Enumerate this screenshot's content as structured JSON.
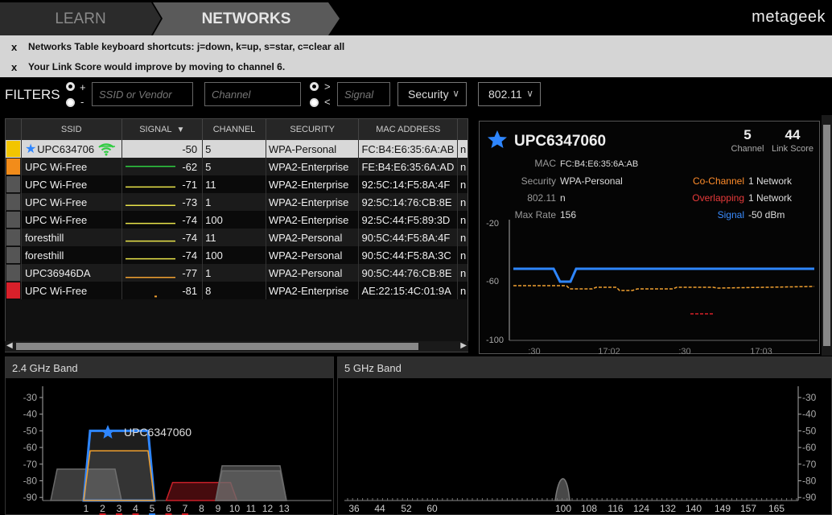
{
  "nav": {
    "learn": "LEARN",
    "networks": "NETWORKS",
    "logo": "metageek"
  },
  "notices": [
    {
      "close": "x",
      "text": "Networks Table keyboard shortcuts: j=down, k=up, s=star, c=clear all"
    },
    {
      "close": "x",
      "text": "Your Link Score would improve by moving to channel 6."
    }
  ],
  "filters": {
    "label": "FILTERS",
    "plus": "+",
    "minus": "-",
    "gt": ">",
    "lt": "<",
    "ssid_placeholder": "SSID or Vendor",
    "channel_placeholder": "Channel",
    "signal_placeholder": "Signal",
    "security": "Security",
    "standard": "802.11"
  },
  "table": {
    "headers": {
      "ssid": "SSID",
      "signal": "SIGNAL",
      "channel": "CHANNEL",
      "security": "SECURITY",
      "mac": "MAC ADDRESS",
      "sort_arrow": "▼"
    },
    "rows": [
      {
        "color": "#f2c500",
        "ssid": "UPC634706",
        "signal": "-50",
        "channel": "5",
        "security": "WPA-Personal",
        "mac": "FC:B4:E6:35:6A:AB",
        "extra": "n",
        "spark": "#2ecc40",
        "starred": true
      },
      {
        "color": "#f28c1a",
        "ssid": "UPC Wi-Free",
        "signal": "-62",
        "channel": "5",
        "security": "WPA2-Enterprise",
        "mac": "FE:B4:E6:35:6A:AD",
        "extra": "n",
        "spark": "#2ecc40"
      },
      {
        "color": "#555555",
        "ssid": "UPC Wi-Free",
        "signal": "-71",
        "channel": "11",
        "security": "WPA2-Enterprise",
        "mac": "92:5C:14:F5:8A:4F",
        "extra": "n",
        "spark": "#e8e34a"
      },
      {
        "color": "#555555",
        "ssid": "UPC Wi-Free",
        "signal": "-73",
        "channel": "1",
        "security": "WPA2-Enterprise",
        "mac": "92:5C:14:76:CB:8E",
        "extra": "n",
        "spark": "#e8e34a"
      },
      {
        "color": "#555555",
        "ssid": "UPC Wi-Free",
        "signal": "-74",
        "channel": "100",
        "security": "WPA2-Enterprise",
        "mac": "92:5C:44:F5:89:3D",
        "extra": "n",
        "spark": "#e8e34a"
      },
      {
        "color": "#555555",
        "ssid": "foresthill",
        "signal": "-74",
        "channel": "11",
        "security": "WPA2-Personal",
        "mac": "90:5C:44:F5:8A:4F",
        "extra": "n",
        "spark": "#e8e34a"
      },
      {
        "color": "#555555",
        "ssid": "foresthill",
        "signal": "-74",
        "channel": "100",
        "security": "WPA2-Personal",
        "mac": "90:5C:44:F5:8A:3C",
        "extra": "n",
        "spark": "#e8e34a"
      },
      {
        "color": "#555555",
        "ssid": "UPC36946DA",
        "signal": "-77",
        "channel": "1",
        "security": "WPA2-Personal",
        "mac": "90:5C:44:76:CB:8E",
        "extra": "n",
        "spark": "#f0a030"
      },
      {
        "color": "#d8202a",
        "ssid": "UPC Wi-Free",
        "signal": "-81",
        "channel": "8",
        "security": "WPA2-Enterprise",
        "mac": "AE:22:15:4C:01:9A",
        "extra": "n",
        "spark": "#f0a030"
      }
    ]
  },
  "details": {
    "ssid": "UPC6347060",
    "channel_value": "5",
    "channel_label": "Channel",
    "link_score_value": "44",
    "link_score_label": "Link Score",
    "mac_label": "MAC",
    "mac_value": "FC:B4:E6:35:6A:AB",
    "security_label": "Security",
    "security_value": "WPA-Personal",
    "standard_label": "802.11",
    "standard_value": "n",
    "maxrate_label": "Max Rate",
    "maxrate_value": "156",
    "cochannel_label": "Co-Channel",
    "cochannel_value": "1 Network",
    "overlap_label": "Overlapping",
    "overlap_value": "1 Network",
    "signal_label": "Signal",
    "signal_value": "-50 dBm",
    "colors": {
      "cochannel": "#ff8c2a",
      "overlap": "#e83a3a",
      "signal": "#3a8cff"
    },
    "chart": {
      "y_ticks": [
        "-20",
        "-60",
        "-100"
      ],
      "x_ticks": [
        ":30",
        "17:02",
        ":30",
        "17:03"
      ]
    }
  },
  "band24": {
    "title": "2.4 GHz Band",
    "y_ticks": [
      "-30",
      "-40",
      "-50",
      "-60",
      "-70",
      "-80",
      "-90"
    ],
    "x_ticks": [
      "1",
      "2",
      "3",
      "4",
      "5",
      "6",
      "7",
      "8",
      "9",
      "10",
      "11",
      "12",
      "13"
    ],
    "highlight_label": "UPC6347060",
    "networks": [
      {
        "channel": 1,
        "dbm": -73,
        "color": "#6a6a6a"
      },
      {
        "channel": 3,
        "dbm": -50,
        "color": "#2e86ff"
      },
      {
        "channel": 3,
        "dbm": -62,
        "color": "#f0a030"
      },
      {
        "channel": 8,
        "dbm": -81,
        "color": "#c82028"
      },
      {
        "channel": 11,
        "dbm": -71,
        "color": "#6a6a6a"
      },
      {
        "channel": 11,
        "dbm": -74,
        "color": "#6a6a6a"
      }
    ]
  },
  "band5": {
    "title": "5 GHz Band",
    "y_ticks": [
      "-30",
      "-40",
      "-50",
      "-60",
      "-70",
      "-80",
      "-90"
    ],
    "x_ticks": [
      "36",
      "44",
      "52",
      "60",
      "100",
      "108",
      "116",
      "124",
      "132",
      "140",
      "149",
      "157",
      "165"
    ]
  }
}
